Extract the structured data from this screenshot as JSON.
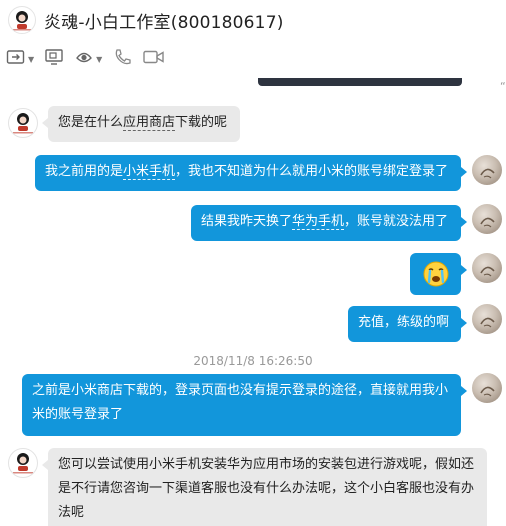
{
  "header": {
    "title": "炎魂-小白工作室(800180617)"
  },
  "toolbar": {
    "buttons": [
      {
        "icon": "file-transfer-icon",
        "has_menu": true
      },
      {
        "icon": "screen-share-icon",
        "has_menu": false
      },
      {
        "icon": "remote-assist-icon",
        "has_menu": true
      },
      {
        "icon": "phone-icon",
        "has_menu": false
      },
      {
        "icon": "video-call-icon",
        "has_menu": false
      }
    ]
  },
  "colors": {
    "outgoing_bubble": "#1296db",
    "incoming_bubble": "#e9e9e9",
    "timestamp": "#999999"
  },
  "messages": [
    {
      "side": "left",
      "parts": [
        "您是在什么",
        "应用商店",
        "下载的呢"
      ]
    },
    {
      "side": "right",
      "parts": [
        "我之前用的是",
        "小米手机",
        "，我也不知道为什么就用小米的账号绑定登录了"
      ]
    },
    {
      "side": "right",
      "parts": [
        "结果我昨天换了",
        "华为手机",
        "，账号就没法用了"
      ]
    },
    {
      "side": "right",
      "emoji": "crying-face-emoji"
    },
    {
      "side": "right",
      "parts": [
        "充值，练级的啊"
      ]
    },
    {
      "side": "right",
      "line1": "之前是小米商店下载的，登录页面也没有提示登录的途径，直接就用我小",
      "line2": "米的账号登录了"
    },
    {
      "side": "left",
      "line1": "您可以尝试使用小米手机安装华为应用市场的安装包进行游戏呢，假如还",
      "line2": "是不行请您咨询一下渠道客服也没有什么办法呢，这个小白客服也没有办",
      "line3": "法呢"
    }
  ],
  "timestamp": "2018/11/8 16:26:50"
}
